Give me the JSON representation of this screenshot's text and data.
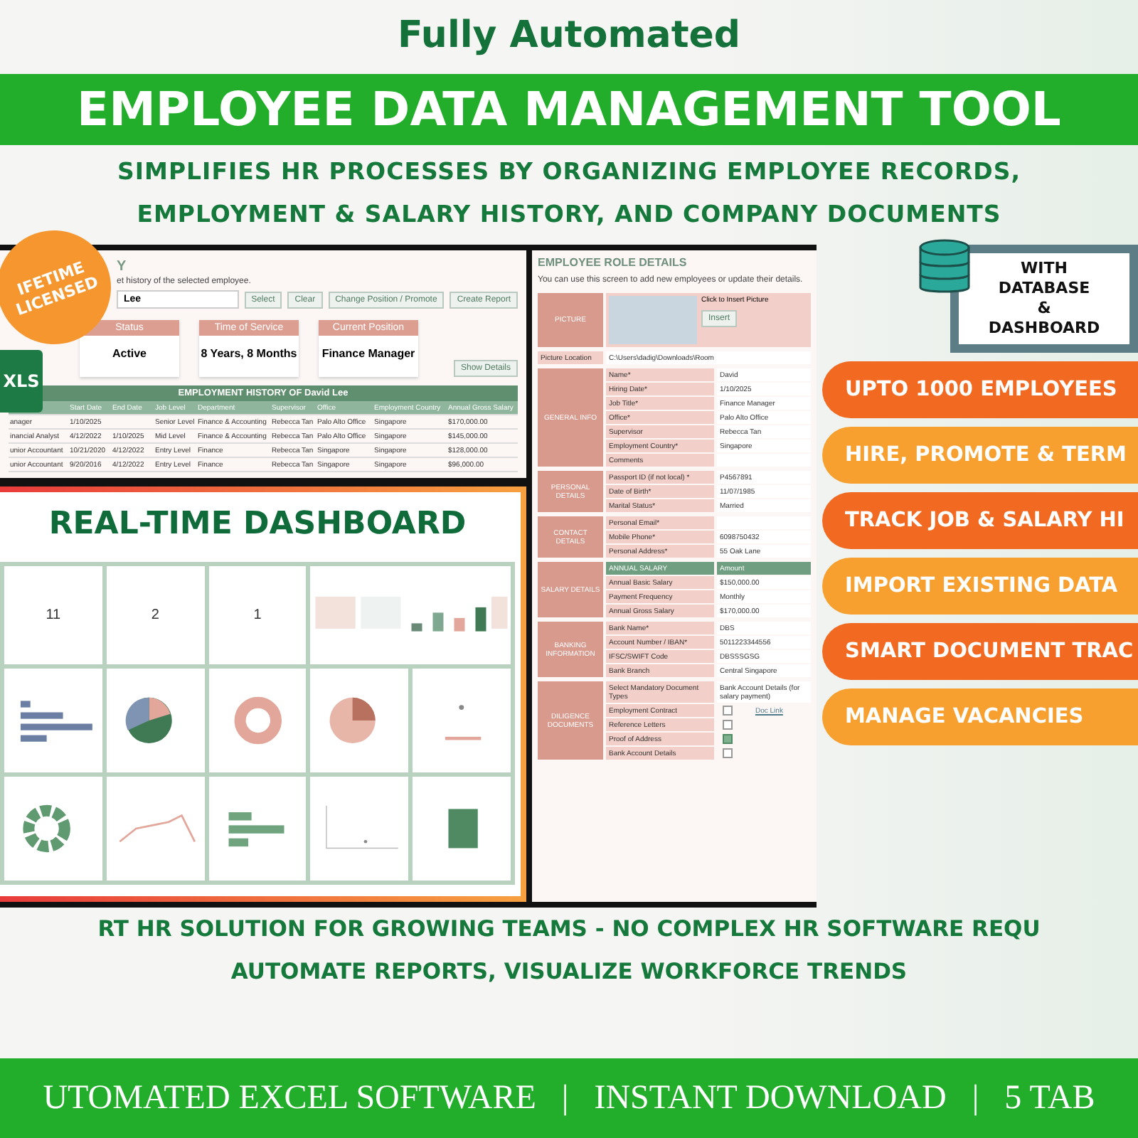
{
  "header": {
    "kicker": "Fully Automated",
    "title": "EMPLOYEE DATA MANAGEMENT TOOL",
    "tagline": [
      "SIMPLIFIES HR PROCESSES BY ORGANIZING EMPLOYEE RECORDS,",
      "EMPLOYMENT & SALARY HISTORY, AND COMPANY DOCUMENTS"
    ]
  },
  "badge": {
    "lines": [
      "IFETIME",
      "LICENSED"
    ]
  },
  "file_icon": {
    "label": "XLS"
  },
  "database_sign": {
    "lines": [
      "WITH",
      "DATABASE",
      "&",
      "DASHBOARD"
    ]
  },
  "history_panel": {
    "heading": "Y",
    "description": "et history of the selected employee.",
    "employee_field": {
      "value": "Lee"
    },
    "buttons": [
      "Select",
      "Clear",
      "Change Position / Promote",
      "Create Report"
    ],
    "stats": [
      {
        "title": "Status",
        "value": "Active"
      },
      {
        "title": "Time of Service",
        "value": "8 Years, 8 Months"
      },
      {
        "title": "Current Position",
        "value": "Finance Manager"
      }
    ],
    "details_button": "Show Details",
    "table": {
      "title": "EMPLOYMENT HISTORY OF David Lee",
      "columns": [
        "",
        "Start Date",
        "End Date",
        "Job Level",
        "Department",
        "Supervisor",
        "Office",
        "Employment Country",
        "Annual Gross Salary"
      ],
      "rows": [
        [
          "anager",
          "1/10/2025",
          "",
          "Senior Level",
          "Finance & Accounting",
          "Rebecca Tan",
          "Palo Alto Office",
          "Singapore",
          "$170,000.00"
        ],
        [
          "inancial Analyst",
          "4/12/2022",
          "1/10/2025",
          "Mid Level",
          "Finance & Accounting",
          "Rebecca Tan",
          "Palo Alto Office",
          "Singapore",
          "$145,000.00"
        ],
        [
          "unior Accountant",
          "10/21/2020",
          "4/12/2022",
          "Entry Level",
          "Finance",
          "Rebecca Tan",
          "Singapore",
          "Singapore",
          "$128,000.00"
        ],
        [
          "unior Accountant",
          "9/20/2016",
          "4/12/2022",
          "Entry Level",
          "Finance",
          "Rebecca Tan",
          "Singapore",
          "Singapore",
          "$96,000.00"
        ]
      ]
    }
  },
  "dashboard": {
    "title": "REAL-TIME DASHBOARD",
    "kpis": [
      "11",
      "2",
      "1"
    ]
  },
  "role_form": {
    "heading": "EMPLOYEE ROLE DETAILS",
    "description": "You can use this screen to add new employees or update their details.",
    "picture": {
      "label": "PICTURE",
      "hint": "Click to Insert Picture",
      "button": "Insert",
      "location_label": "Picture Location",
      "location": "C:\\Users\\dadig\\Downloads\\Room"
    },
    "sections": [
      {
        "label": "GENERAL INFO",
        "rows": [
          {
            "field": "Name*",
            "value": "David"
          },
          {
            "field": "Hiring Date*",
            "value": "1/10/2025"
          },
          {
            "field": "Job Title*",
            "value": "Finance Manager"
          },
          {
            "field": "Office*",
            "value": "Palo Alto Office"
          },
          {
            "field": "Supervisor",
            "value": "Rebecca Tan"
          },
          {
            "field": "Employment Country*",
            "value": "Singapore"
          },
          {
            "field": "Comments"
          }
        ]
      },
      {
        "label": "PERSONAL DETAILS",
        "rows": [
          {
            "field": "Passport ID (if not local) *",
            "value": "P4567891"
          },
          {
            "field": "Date of Birth*",
            "value": "11/07/1985"
          },
          {
            "field": "Marital Status*",
            "value": "Married"
          }
        ]
      },
      {
        "label": "CONTACT DETAILS",
        "rows": [
          {
            "field": "Personal Email*"
          },
          {
            "field": "Mobile Phone*",
            "value": "6098750432"
          },
          {
            "field": "Personal Address*",
            "value": "55 Oak Lane"
          }
        ]
      },
      {
        "label": "SALARY DETAILS",
        "header": [
          "ANNUAL SALARY",
          "Amount"
        ],
        "rows": [
          {
            "field": "Annual Basic Salary",
            "value": "$150,000.00"
          },
          {
            "field": "Payment Frequency",
            "value": "Monthly"
          },
          {
            "field": "Annual Gross Salary",
            "value": "$170,000.00"
          }
        ]
      },
      {
        "label": "BANKING INFORMATION",
        "rows": [
          {
            "field": "Bank Name*",
            "value": "DBS"
          },
          {
            "field": "Account Number / IBAN*",
            "value": "5011223344556"
          },
          {
            "field": "IFSC/SWIFT Code",
            "value": "DBSSSGSG"
          },
          {
            "field": "Bank Branch",
            "value": "Central Singapore"
          }
        ]
      }
    ],
    "diligence": {
      "label": "DILIGENCE DOCUMENTS",
      "select_label": "Select Mandatory Document Types",
      "select_value": "Bank Account Details (for salary payment)",
      "link": "Doc Link",
      "documents": [
        {
          "name": "Employment Contract",
          "checked": false
        },
        {
          "name": "Reference Letters",
          "checked": false
        },
        {
          "name": "Proof of Address",
          "checked": true
        },
        {
          "name": "Bank Account Details",
          "checked": false
        }
      ]
    }
  },
  "features": [
    {
      "label": "UPTO 1000 EMPLOYEES",
      "color": "#f26a21"
    },
    {
      "label": "HIRE, PROMOTE & TERM",
      "color": "#f7a030"
    },
    {
      "label": "TRACK JOB & SALARY HI",
      "color": "#f26a21"
    },
    {
      "label": "IMPORT EXISTING DATA",
      "color": "#f7a030"
    },
    {
      "label": "SMART DOCUMENT TRAC",
      "color": "#f26a21"
    },
    {
      "label": "MANAGE VACANCIES",
      "color": "#f7a030"
    }
  ],
  "footer": {
    "lines": [
      "RT HR SOLUTION FOR GROWING TEAMS - NO COMPLEX HR SOFTWARE REQU",
      "AUTOMATE REPORTS, VISUALIZE WORKFORCE TRENDS"
    ],
    "band": {
      "items": [
        "UTOMATED EXCEL SOFTWARE",
        "INSTANT DOWNLOAD",
        "5 TAB"
      ],
      "separator": "|"
    }
  }
}
